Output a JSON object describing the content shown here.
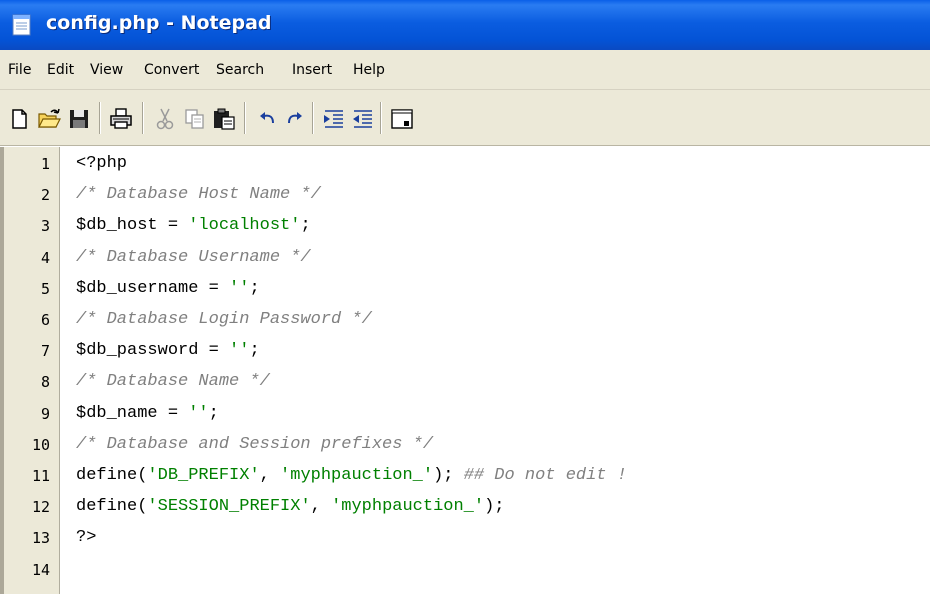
{
  "window": {
    "title": "config.php - Notepad"
  },
  "menu": {
    "items": [
      "File",
      "Edit",
      "View",
      "Convert",
      "Search",
      "Insert",
      "Help"
    ]
  },
  "toolbar": {
    "buttons": [
      "new-icon",
      "open-icon",
      "save-icon",
      "print-icon",
      "cut-icon",
      "copy-icon",
      "paste-icon",
      "undo-icon",
      "redo-icon",
      "indent-icon",
      "outdent-icon",
      "window-icon"
    ]
  },
  "editor": {
    "line_numbers": [
      "1",
      "2",
      "3",
      "4",
      "5",
      "6",
      "7",
      "8",
      "9",
      "10",
      "11",
      "12",
      "13",
      "14"
    ],
    "lines": [
      [
        {
          "t": "<?php",
          "c": "ph"
        }
      ],
      [
        {
          "t": "/* Database Host Name */",
          "c": "cm"
        }
      ],
      [
        {
          "t": "$db_host = ",
          "c": "ph"
        },
        {
          "t": "'localhost'",
          "c": "str"
        },
        {
          "t": ";",
          "c": "ph"
        }
      ],
      [
        {
          "t": "/* Database Username */",
          "c": "cm"
        }
      ],
      [
        {
          "t": "$db_username = ",
          "c": "ph"
        },
        {
          "t": "''",
          "c": "str"
        },
        {
          "t": ";",
          "c": "ph"
        }
      ],
      [
        {
          "t": "/* Database Login Password */",
          "c": "cm"
        }
      ],
      [
        {
          "t": "$db_password = ",
          "c": "ph"
        },
        {
          "t": "''",
          "c": "str"
        },
        {
          "t": ";",
          "c": "ph"
        }
      ],
      [
        {
          "t": "/* Database Name */",
          "c": "cm"
        }
      ],
      [
        {
          "t": "$db_name = ",
          "c": "ph"
        },
        {
          "t": "''",
          "c": "str"
        },
        {
          "t": ";",
          "c": "ph"
        }
      ],
      [
        {
          "t": "/* Database and Session prefixes */",
          "c": "cm"
        }
      ],
      [
        {
          "t": "define(",
          "c": "ph"
        },
        {
          "t": "'DB_PREFIX'",
          "c": "str"
        },
        {
          "t": ", ",
          "c": "ph"
        },
        {
          "t": "'myphpauction_'",
          "c": "str"
        },
        {
          "t": "); ",
          "c": "ph"
        },
        {
          "t": "## Do not edit !",
          "c": "cm"
        }
      ],
      [
        {
          "t": "define(",
          "c": "ph"
        },
        {
          "t": "'SESSION_PREFIX'",
          "c": "str"
        },
        {
          "t": ", ",
          "c": "ph"
        },
        {
          "t": "'myphpauction_'",
          "c": "str"
        },
        {
          "t": ");",
          "c": "ph"
        }
      ],
      [
        {
          "t": "?>",
          "c": "ph"
        }
      ],
      []
    ]
  },
  "colors": {
    "titlebar": "#0453d6",
    "chrome": "#ece9d8",
    "comment": "#808080",
    "string": "#008000"
  }
}
